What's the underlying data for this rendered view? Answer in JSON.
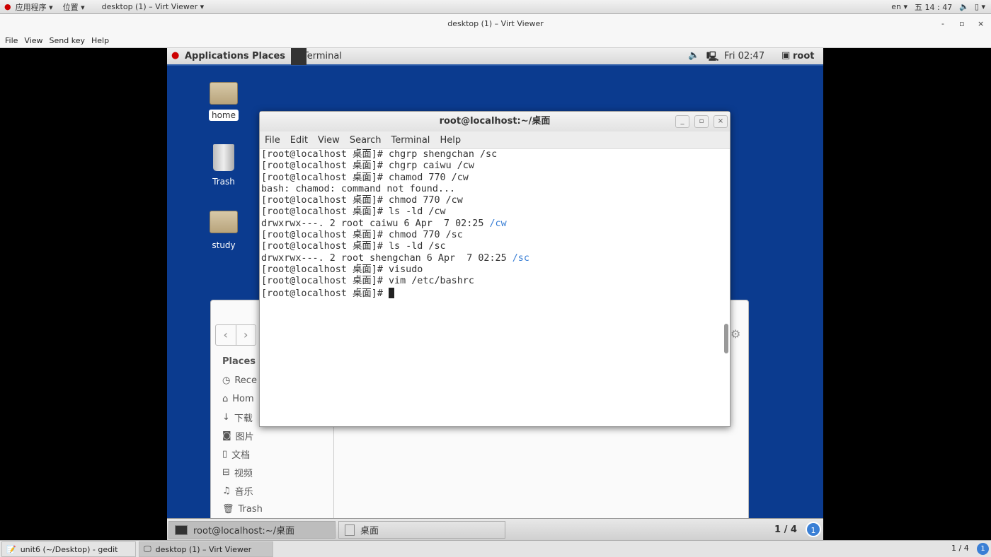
{
  "host_panel": {
    "apps": "应用程序 ▾",
    "places": "位置 ▾",
    "window": "desktop (1) – Virt Viewer ▾",
    "lang": "en ▾",
    "clock": "五 14 : 47"
  },
  "viewer": {
    "title": "desktop (1) – Virt Viewer",
    "menu": [
      "File",
      "View",
      "Send key",
      "Help"
    ],
    "controls": [
      "-",
      "▫",
      "×"
    ]
  },
  "guest_top": {
    "applications": "Applications",
    "places": "Places",
    "terminal": "Terminal",
    "clock": "Fri 02:47",
    "user": "root"
  },
  "desktop_icons": [
    {
      "label": "home"
    },
    {
      "label": "Trash"
    },
    {
      "label": "study"
    }
  ],
  "file_manager": {
    "places_heading": "Places",
    "items": [
      "Rece",
      "Hom",
      "下载",
      "图片",
      "文档",
      "视频",
      "音乐",
      "Trash"
    ]
  },
  "terminal": {
    "title": "root@localhost:~/桌面",
    "menu": [
      "File",
      "Edit",
      "View",
      "Search",
      "Terminal",
      "Help"
    ],
    "lines": [
      [
        {
          "t": "[root@localhost 桌面]# chgrp shengchan /sc"
        }
      ],
      [
        {
          "t": "[root@localhost 桌面]# chgrp caiwu /cw"
        }
      ],
      [
        {
          "t": "[root@localhost 桌面]# chamod 770 /cw"
        }
      ],
      [
        {
          "t": "bash: chamod: command not found..."
        }
      ],
      [
        {
          "t": "[root@localhost 桌面]# chmod 770 /cw"
        }
      ],
      [
        {
          "t": "[root@localhost 桌面]# ls -ld /cw"
        }
      ],
      [
        {
          "t": "drwxrwx---. 2 root caiwu 6 Apr  7 02:25 "
        },
        {
          "t": "/cw",
          "c": "blue"
        }
      ],
      [
        {
          "t": "[root@localhost 桌面]# chmod 770 /sc"
        }
      ],
      [
        {
          "t": "[root@localhost 桌面]# ls -ld /sc"
        }
      ],
      [
        {
          "t": "drwxrwx---. 2 root shengchan 6 Apr  7 02:25 "
        },
        {
          "t": "/sc",
          "c": "blue"
        }
      ],
      [
        {
          "t": "[root@localhost 桌面]# visudo"
        }
      ],
      [
        {
          "t": "[root@localhost 桌面]# vim /etc/bashrc"
        }
      ],
      [
        {
          "t": "[root@localhost 桌面]# "
        },
        {
          "cursor": true
        }
      ]
    ]
  },
  "guest_taskbar": {
    "tasks": [
      "root@localhost:~/桌面",
      "桌面"
    ],
    "workspace": "1 / 4",
    "badge": "1"
  },
  "host_taskbar": {
    "tasks": [
      "unit6 (~/Desktop) - gedit",
      "desktop (1) – Virt Viewer"
    ],
    "workspace": "1 / 4",
    "badge": "1"
  },
  "colors": {
    "desktop": "#0b3b8f",
    "link": "#3a7fd5"
  }
}
